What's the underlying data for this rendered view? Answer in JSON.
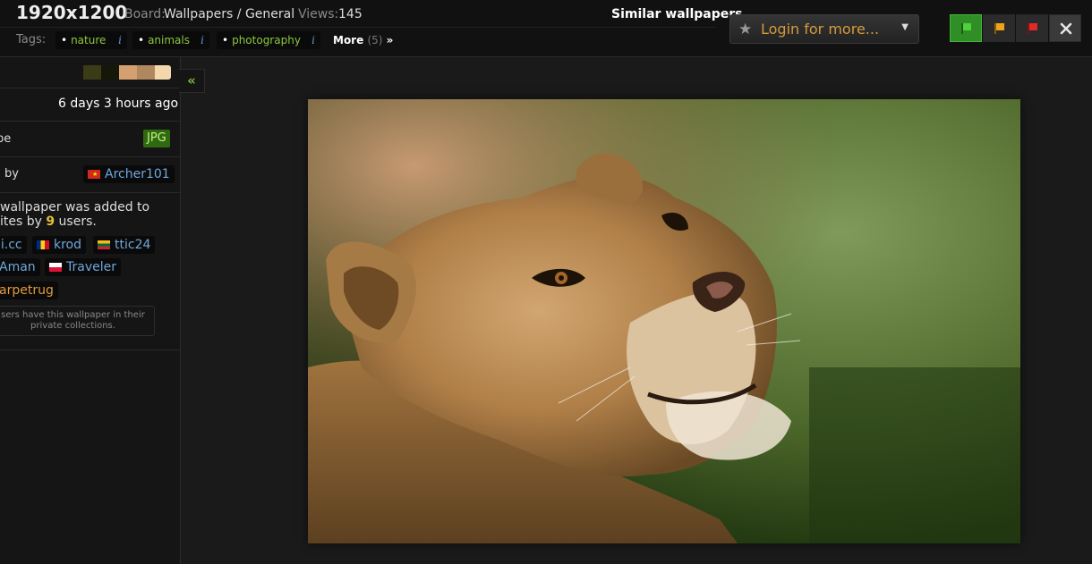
{
  "header": {
    "resolution": "1920x1200",
    "board_label": "Board:",
    "board_value": "Wallpapers / General",
    "views_label": "Views:",
    "views_value": "145",
    "tags_label": "Tags:",
    "tags": [
      {
        "name": "nature",
        "info": "i"
      },
      {
        "name": "animals",
        "info": "i"
      },
      {
        "name": "photography",
        "info": "i"
      }
    ],
    "more_label": "More",
    "more_count": "(5)",
    "more_arrow": "»",
    "similar_label": "Similar wallpapers",
    "login_label": "Login for more...",
    "star_icon": "star-icon",
    "purity_buttons": [
      {
        "name": "sfw",
        "color": "#46c33a"
      },
      {
        "name": "sketchy",
        "color": "#f0a21a"
      },
      {
        "name": "nsfw",
        "color": "#e02a2a"
      },
      {
        "name": "close",
        "color": "#e6e6e6"
      }
    ]
  },
  "sidebar": {
    "palette": [
      "#3a3c16",
      "#151808",
      "#d4a070",
      "#b08860",
      "#f3d7ad"
    ],
    "collapse_label": "«",
    "added_value": "6 days  3 hours ago",
    "type_label": "pe",
    "type_value": "JPG",
    "uploader_label": " by",
    "uploader": {
      "name": "Archer101",
      "flag": "vn"
    },
    "favorites_line1": "wallpaper was added to",
    "favorites_line2_prefix": "ites by ",
    "favorites_count": "9",
    "favorites_line2_suffix": " users.",
    "fav_users": [
      {
        "name": "li.cc",
        "flag": ""
      },
      {
        "name": "krod",
        "flag": "ro"
      },
      {
        "name": "ttic24",
        "flag": "lt"
      },
      {
        "name": "Aman",
        "flag": ""
      },
      {
        "name": "Traveler",
        "flag": "pl"
      },
      {
        "name": "arpetrug",
        "flag": ""
      }
    ],
    "private_note_line1": "sers have this wallpaper in their",
    "private_note_line2": "private collections."
  },
  "main": {
    "image_alt": "lioness photo"
  }
}
